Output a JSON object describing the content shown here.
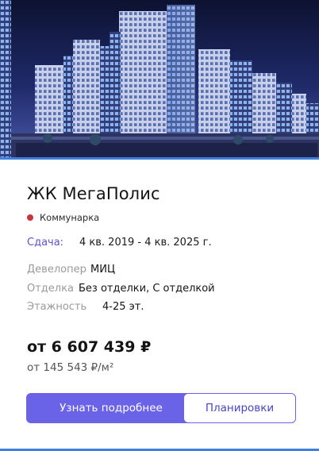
{
  "complex": {
    "name": "ЖК МегаПолис",
    "metro": "Коммунарка",
    "metro_color": "#c8343c"
  },
  "deadline": {
    "label": "Сдача:",
    "value": "4 кв. 2019 - 4 кв. 2025 г."
  },
  "specs": [
    {
      "label": "Девелопер",
      "value": "МИЦ"
    },
    {
      "label": "Отделка",
      "value": "Без отделки, С отделкой"
    },
    {
      "label": "Этажность",
      "value": "4-25 эт."
    }
  ],
  "price": {
    "total": "от 6 607 439 ₽",
    "per_m2": "от 145 543 ₽/м²"
  },
  "buttons": {
    "details": "Узнать подробнее",
    "plans": "Планировки"
  },
  "colors": {
    "accent": "#6a63e8",
    "divider": "#3e7fe0"
  },
  "hero": {
    "icon": "building-render-image"
  }
}
